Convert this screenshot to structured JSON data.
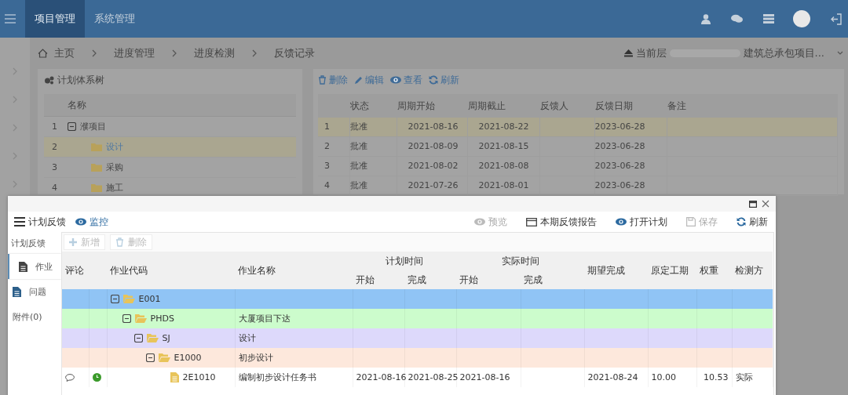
{
  "topbar": {
    "tabs": [
      {
        "label": "项目管理",
        "selected": true
      },
      {
        "label": "系统管理",
        "selected": false
      }
    ]
  },
  "breadcrumb": {
    "items": [
      "主页",
      "进度管理",
      "进度检测",
      "反馈记录"
    ],
    "scope_label": "当前层",
    "scope_value": "建筑总承包项目..."
  },
  "plan_tree": {
    "title": "计划体系树",
    "column": "名称",
    "rows": [
      {
        "number": "1",
        "name": "濮项目",
        "selected": false,
        "expanded": true,
        "children": [
          {
            "number": "2",
            "name": "设计",
            "selected": true
          },
          {
            "number": "3",
            "name": "采购",
            "selected": false
          },
          {
            "number": "4",
            "name": "施工",
            "selected": false
          }
        ]
      }
    ]
  },
  "records": {
    "toolbar": [
      "删除",
      "编辑",
      "查看",
      "刷新"
    ],
    "columns": [
      "状态",
      "周期开始",
      "周期截止",
      "反馈人",
      "反馈日期",
      "备注"
    ],
    "rows": [
      {
        "number": "1",
        "status": "批准",
        "period_start": "2021-08-16",
        "period_end": "2021-08-22",
        "feedback_date": "2023-06-28",
        "selected": true
      },
      {
        "number": "2",
        "status": "批准",
        "period_start": "2021-08-09",
        "period_end": "2021-08-15",
        "feedback_date": "2023-06-28",
        "selected": false
      },
      {
        "number": "3",
        "status": "批准",
        "period_start": "2021-08-02",
        "period_end": "2021-08-08",
        "feedback_date": "2023-06-28",
        "selected": false
      },
      {
        "number": "4",
        "status": "批准",
        "period_start": "2021-07-26",
        "period_end": "2021-08-01",
        "feedback_date": "2023-06-28",
        "selected": false
      }
    ]
  },
  "dialog": {
    "header_items": [
      "计划反馈",
      "监控"
    ],
    "actions": [
      {
        "label": "预览",
        "disabled": true
      },
      {
        "label": "本期反馈报告",
        "disabled": false
      },
      {
        "label": "打开计划",
        "disabled": false
      },
      {
        "label": "保存",
        "disabled": true
      },
      {
        "label": "刷新",
        "disabled": false
      }
    ],
    "side_nav": {
      "heading": "计划反馈",
      "items": [
        {
          "label": "作业",
          "selected": true
        },
        {
          "label": "问题",
          "selected": false
        },
        {
          "label": "附件(0)",
          "selected": false
        }
      ]
    },
    "sub_toolbar": [
      {
        "label": "新增",
        "disabled": true
      },
      {
        "label": "删除",
        "disabled": true
      }
    ],
    "columns": {
      "comment": "评论",
      "code": "作业代码",
      "name": "作业名称",
      "plan_time": "计划时间",
      "plan_start": "开始",
      "plan_finish": "完成",
      "actual_time": "实际时间",
      "actual_start": "开始",
      "actual_finish": "完成",
      "expected_finish": "期望完成",
      "original_duration": "原定工期",
      "weight": "权重",
      "check_method": "检测方"
    },
    "rows": [
      {
        "code": "E001",
        "color": "#90c4f5",
        "expanded": true,
        "children": [
          {
            "code": "PHDS",
            "name": "大厦项目下达",
            "color": "#ccfccc",
            "expanded": true,
            "children": [
              {
                "code": "SJ",
                "name": "设计",
                "color": "#ddd9fb",
                "expanded": true,
                "children": [
                  {
                    "code": "E1000",
                    "name": "初步设计",
                    "color": "#fde8dc",
                    "expanded": true,
                    "children": [
                      {
                        "code": "2E1010",
                        "name": "编制初步设计任务书",
                        "color": "#ffffff",
                        "has_comment": true,
                        "progress_icon": true,
                        "plan_start": "2021-08-16",
                        "plan_finish": "2021-08-25",
                        "actual_start": "2021-08-16",
                        "expected_finish": "2021-08-24",
                        "original_duration": "10.00",
                        "weight": "10.53",
                        "check_method": "实际"
                      }
                    ]
                  }
                ]
              }
            ]
          }
        ]
      }
    ]
  }
}
